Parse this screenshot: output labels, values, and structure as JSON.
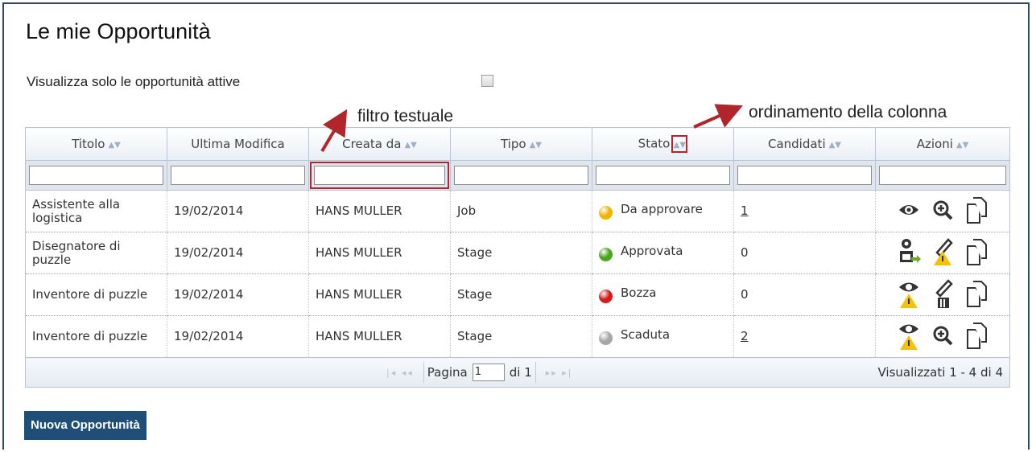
{
  "page": {
    "title": "Le mie Opportunità",
    "filter_label": "Visualizza solo le opportunità attive",
    "filter_checked": false
  },
  "annotations": {
    "text_filter": "filtro testuale",
    "column_sort": "ordinamento della colonna",
    "color": "#b0262c"
  },
  "table": {
    "columns": [
      "Titolo",
      "Ultima Modifica",
      "Creata da",
      "Tipo",
      "Stato",
      "Candidati",
      "Azioni"
    ],
    "rows": [
      {
        "titolo": "Assistente alla logistica",
        "modifica": "19/02/2014",
        "creata_da": "HANS MULLER",
        "tipo": "Job",
        "stato": "Da approvare",
        "stato_color": "#f2b400",
        "candidati": "1",
        "actions": [
          "eye-icon",
          "zoom-in-icon",
          "copy-icon"
        ]
      },
      {
        "titolo": "Disegnatore di puzzle",
        "modifica": "19/02/2014",
        "creata_da": "HANS MULLER",
        "tipo": "Stage",
        "stato": "Approvata",
        "stato_color": "#4aa61e",
        "candidati": "0",
        "actions": [
          "publish-icon",
          "edit-warning-icon",
          "copy-icon"
        ]
      },
      {
        "titolo": "Inventore di puzzle",
        "modifica": "19/02/2014",
        "creata_da": "HANS MULLER",
        "tipo": "Stage",
        "stato": "Bozza",
        "stato_color": "#d61a1a",
        "candidati": "0",
        "actions": [
          "eye-warning-icon",
          "edit-delete-icon",
          "copy-icon"
        ]
      },
      {
        "titolo": "Inventore di puzzle",
        "modifica": "19/02/2014",
        "creata_da": "HANS MULLER",
        "tipo": "Stage",
        "stato": "Scaduta",
        "stato_color": "#a6a6a6",
        "candidati": "2",
        "actions": [
          "eye-warning-icon",
          "zoom-in-icon",
          "copy-icon"
        ]
      }
    ]
  },
  "pager": {
    "page_label": "Pagina",
    "page_value": "1",
    "of_label": "di 1",
    "summary": "Visualizzati 1 - 4 di 4"
  },
  "buttons": {
    "new_opportunity": "Nuova Opportunità"
  }
}
